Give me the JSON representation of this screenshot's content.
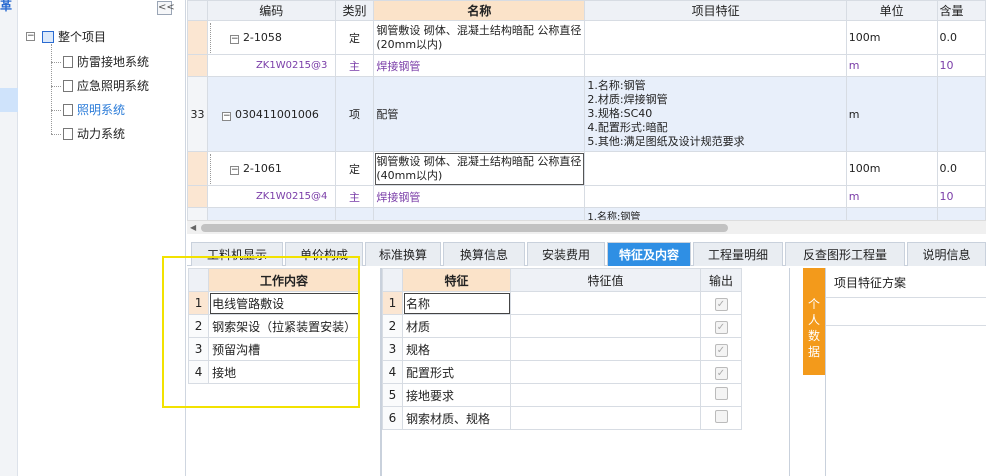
{
  "strip": {
    "mark": "革"
  },
  "tree": {
    "collapse_label": "<<",
    "root": "整个项目",
    "items": [
      "防雷接地系统",
      "应急照明系统",
      "照明系统",
      "动力系统"
    ]
  },
  "grid": {
    "headers": [
      "",
      "编码",
      "类别",
      "名称",
      "项目特征",
      "单位",
      "含量"
    ],
    "rows": [
      {
        "rowno": "",
        "code": "2-1058",
        "type": "定",
        "name": "钢管敷设 砌体、混凝土结构暗配 公称直径(20mm以内)",
        "feature": "",
        "unit": "100m",
        "qty": "0.0"
      },
      {
        "rowno": "",
        "code": "ZK1W0215@3",
        "type": "主",
        "name": "焊接钢管",
        "feature": "",
        "unit": "m",
        "qty": "10"
      },
      {
        "rowno": "33",
        "code": "030411001006",
        "type": "项",
        "name": "配管",
        "feature": "1.名称:钢管\n2.材质:焊接钢管\n3.规格:SC40\n4.配置形式:暗配\n5.其他:满足图纸及设计规范要求",
        "unit": "m",
        "qty": ""
      },
      {
        "rowno": "",
        "code": "2-1061",
        "type": "定",
        "name": "钢管敷设 砌体、混凝土结构暗配 公称直径(40mm以内)",
        "feature": "",
        "unit": "100m",
        "qty": "0.0"
      },
      {
        "rowno": "",
        "code": "ZK1W0215@4",
        "type": "主",
        "name": "焊接钢管",
        "feature": "",
        "unit": "m",
        "qty": "10"
      },
      {
        "rowno": "",
        "code": "",
        "type": "",
        "name": "",
        "feature": "1.名称:钢管",
        "unit": "",
        "qty": ""
      }
    ]
  },
  "tabs": [
    "工料机显示",
    "单价构成",
    "标准换算",
    "换算信息",
    "安装费用",
    "特征及内容",
    "工程量明细",
    "反查图形工程量",
    "说明信息"
  ],
  "work_content": {
    "header": "工作内容",
    "rows": [
      {
        "no": "1",
        "text": "电线管路敷设"
      },
      {
        "no": "2",
        "text": "钢索架设（拉紧装置安装）"
      },
      {
        "no": "3",
        "text": "预留沟槽"
      },
      {
        "no": "4",
        "text": "接地"
      }
    ]
  },
  "features": {
    "headers": [
      "特征",
      "特征值",
      "输出"
    ],
    "rows": [
      {
        "no": "1",
        "name": "名称",
        "value": "",
        "checked": "✓"
      },
      {
        "no": "2",
        "name": "材质",
        "value": "",
        "checked": "✓"
      },
      {
        "no": "3",
        "name": "规格",
        "value": "",
        "checked": "✓"
      },
      {
        "no": "4",
        "name": "配置形式",
        "value": "",
        "checked": "✓"
      },
      {
        "no": "5",
        "name": "接地要求",
        "value": "",
        "checked": ""
      },
      {
        "no": "6",
        "name": "钢索材质、规格",
        "value": "",
        "checked": ""
      }
    ]
  },
  "right_panel": {
    "vertical_label": "个人数据",
    "header": "项目特征方案"
  },
  "colors": {
    "active_tab": "#2f8fe4",
    "orange": "#f39a1b",
    "highlight": "#f2e200",
    "sub_item": "#7a3da8"
  }
}
